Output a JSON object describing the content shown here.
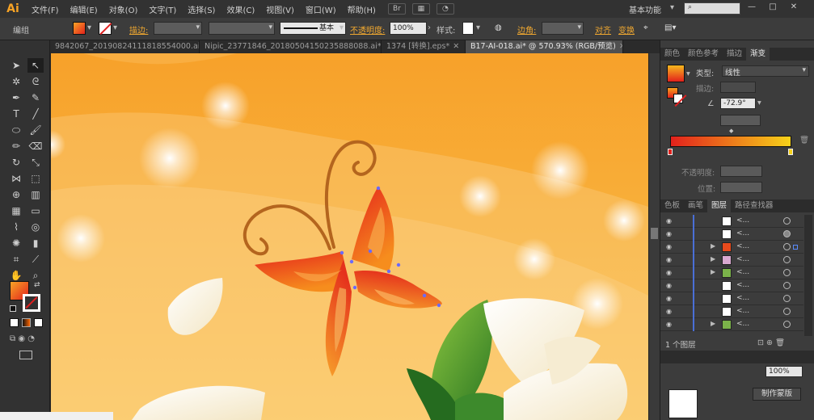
{
  "menubar": {
    "logo": "Ai",
    "items": [
      "文件(F)",
      "编辑(E)",
      "对象(O)",
      "文字(T)",
      "选择(S)",
      "效果(C)",
      "视图(V)",
      "窗口(W)",
      "帮助(H)"
    ],
    "workspace": "基本功能",
    "search_placeholder": "",
    "window_buttons": [
      "—",
      "□",
      "✕"
    ]
  },
  "controlbar": {
    "selection_label": "编组",
    "stroke_label": "描边:",
    "stroke_style": "基本",
    "opacity_label": "不透明度:",
    "opacity_value": "100%",
    "style_label": "样式:",
    "corner_label": "边角:",
    "align_label": "对齐",
    "transform_label": "变换"
  },
  "doctabs": [
    {
      "label": "9842067_20190824111818554000.ai*",
      "active": false
    },
    {
      "label": "Nipic_23771846_20180504150235888088.ai*",
      "active": false
    },
    {
      "label": "1374 [转换].eps*",
      "active": false
    },
    {
      "label": "B17-AI-018.ai* @ 570.93% (RGB/预览)",
      "active": true
    }
  ],
  "gradient_panel": {
    "tabs": [
      "颜色",
      "颜色参考",
      "描边",
      "渐变"
    ],
    "active_tab": "渐变",
    "type_label": "类型:",
    "type_value": "线性",
    "stroke_label": "描边:",
    "angle_value": "-72.9°",
    "opacity_label": "不透明度:",
    "location_label": "位置:",
    "gradient_start": "#e2211c",
    "gradient_end": "#f7d21a"
  },
  "layers_panel": {
    "tabs": [
      "色板",
      "画笔",
      "图层",
      "路径查找器"
    ],
    "active_tab": "图层",
    "rows": [
      {
        "name": "<...",
        "thumb": "#ffffff",
        "expandable": false,
        "target_filled": false
      },
      {
        "name": "<...",
        "thumb": "#ffffff",
        "expandable": false,
        "target_filled": true
      },
      {
        "name": "<...",
        "thumb": "#e84a1c",
        "expandable": true,
        "target_filled": false
      },
      {
        "name": "<...",
        "thumb": "#d9a8d0",
        "expandable": true,
        "target_filled": false
      },
      {
        "name": "<...",
        "thumb": "#7bb34a",
        "expandable": true,
        "target_filled": false
      },
      {
        "name": "<...",
        "thumb": "#ffffff",
        "expandable": false,
        "target_filled": false
      },
      {
        "name": "<...",
        "thumb": "#ffffff",
        "expandable": false,
        "target_filled": false
      },
      {
        "name": "<...",
        "thumb": "#ffffff",
        "expandable": false,
        "target_filled": false
      },
      {
        "name": "<...",
        "thumb": "#7bb34a",
        "expandable": true,
        "target_filled": false
      }
    ],
    "footer_label": "1 个图层"
  },
  "lower_panel": {
    "opacity_value": "100%",
    "make_mask_label": "制作蒙版"
  },
  "colors": {
    "accent": "#f0a830",
    "canvas_top": "#f7a72c",
    "canvas_bottom": "#f9c04e"
  }
}
